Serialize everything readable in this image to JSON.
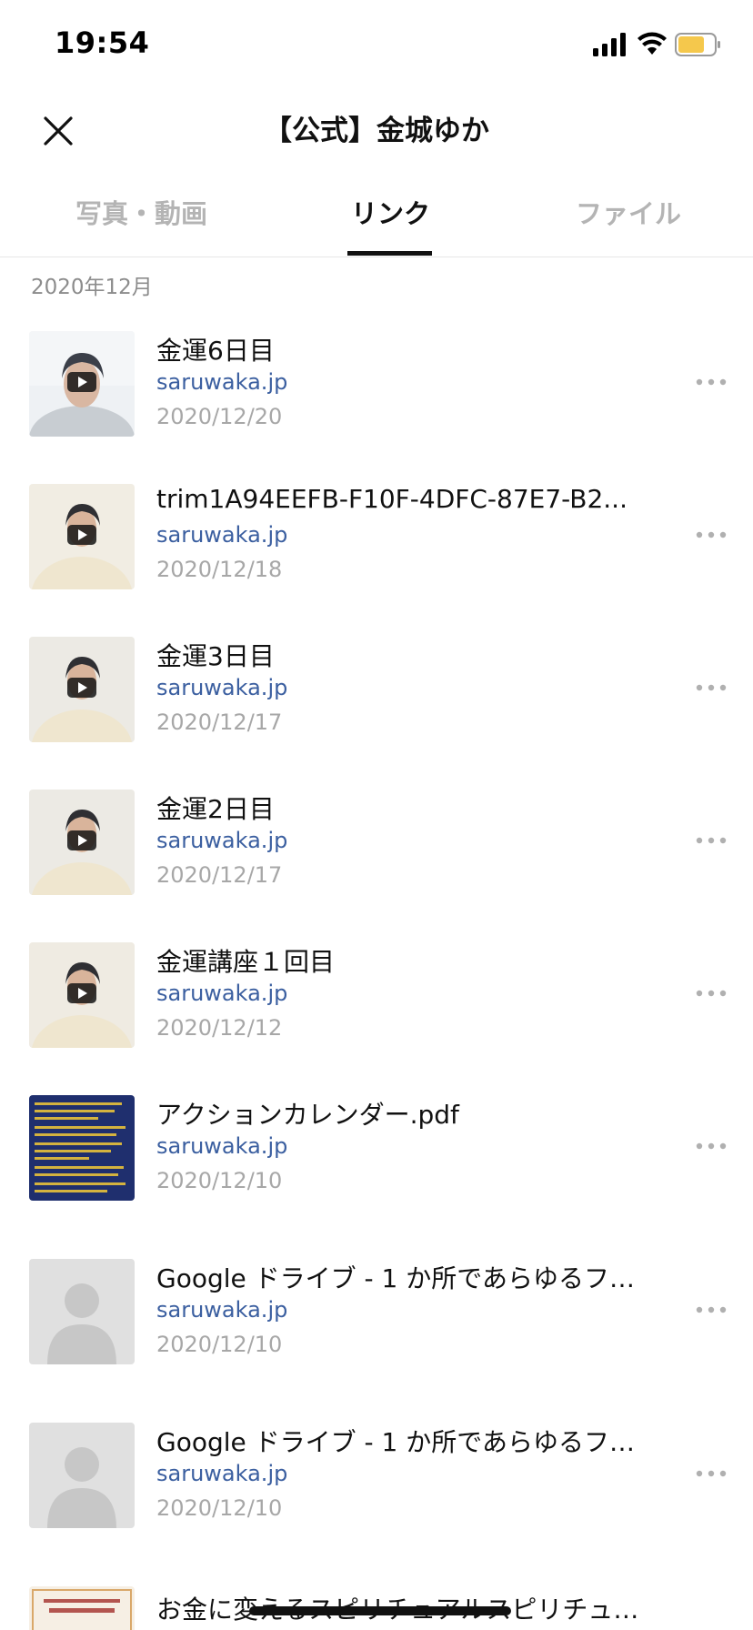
{
  "status_bar": {
    "time": "19:54",
    "battery_color": "#f5c84c"
  },
  "header": {
    "title": "【公式】金城ゆか"
  },
  "tabs": [
    {
      "label": "写真・動画",
      "active": false
    },
    {
      "label": "リンク",
      "active": true
    },
    {
      "label": "ファイル",
      "active": false
    }
  ],
  "section": {
    "label": "2020年12月"
  },
  "items": [
    {
      "title": "金運6日目",
      "domain": "saruwaka.jp",
      "date": "2020/12/20",
      "thumb": "video-portrait-grey"
    },
    {
      "title": "trim1A94EEFB-F10F-4DFC-87E7-B2...",
      "domain": "saruwaka.jp",
      "date": "2020/12/18",
      "thumb": "video-portrait-cream"
    },
    {
      "title": "金運3日目",
      "domain": "saruwaka.jp",
      "date": "2020/12/17",
      "thumb": "video-portrait-cream"
    },
    {
      "title": "金運2日目",
      "domain": "saruwaka.jp",
      "date": "2020/12/17",
      "thumb": "video-portrait-cream"
    },
    {
      "title": "金運講座１回目",
      "domain": "saruwaka.jp",
      "date": "2020/12/12",
      "thumb": "video-portrait-cream"
    },
    {
      "title": "アクションカレンダー.pdf",
      "domain": "saruwaka.jp",
      "date": "2020/12/10",
      "thumb": "document-navy"
    },
    {
      "title": "Google ドライブ - 1 か所であらゆるフ…",
      "domain": "saruwaka.jp",
      "date": "2020/12/10",
      "thumb": "placeholder-person"
    },
    {
      "title": "Google ドライブ - 1 か所であらゆるフ…",
      "domain": "saruwaka.jp",
      "date": "2020/12/10",
      "thumb": "placeholder-person"
    },
    {
      "title": "お金に変えるスピリチュアルスピリチュ…",
      "domain": "",
      "date": "",
      "thumb": "flyer"
    }
  ]
}
